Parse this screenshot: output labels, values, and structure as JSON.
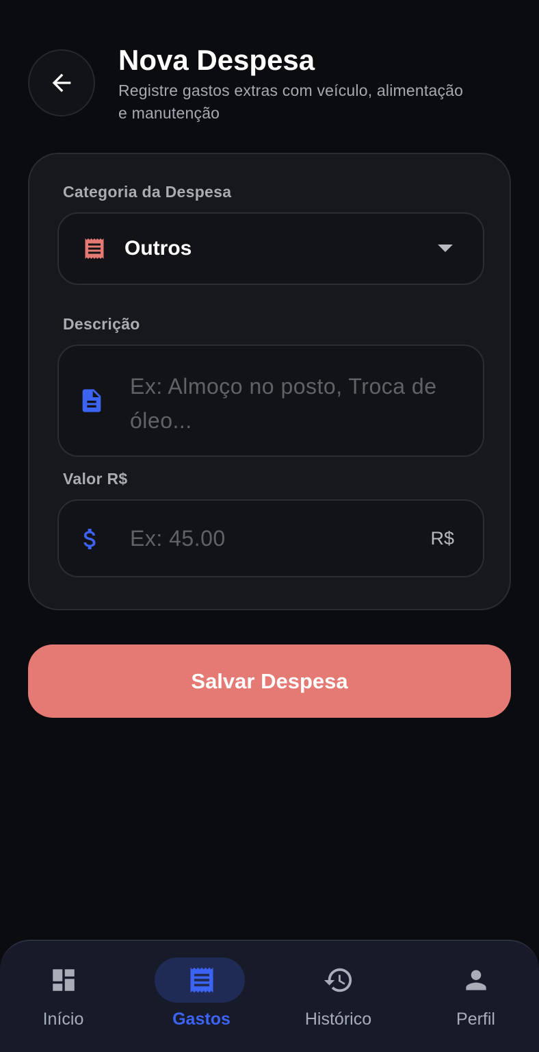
{
  "header": {
    "title": "Nova Despesa",
    "subtitle_line1": "Registre gastos extras com veículo, alimentação",
    "subtitle_line2": "e manutenção"
  },
  "form": {
    "category": {
      "label": "Categoria da Despesa",
      "selected": "Outros",
      "icon": "receipt-icon"
    },
    "description": {
      "label": "Descrição",
      "placeholder_line1": "Ex: Almoço no posto, Troca de",
      "placeholder_line2": "óleo...",
      "icon": "document-icon"
    },
    "amount": {
      "label": "Valor R$",
      "placeholder": "Ex: 45.00",
      "suffix": "R$",
      "icon": "dollar-icon"
    }
  },
  "save_button": {
    "label": "Salvar Despesa"
  },
  "nav": {
    "items": [
      {
        "label": "Início",
        "icon": "dashboard-icon",
        "active": false
      },
      {
        "label": "Gastos",
        "icon": "receipt-icon",
        "active": true
      },
      {
        "label": "Histórico",
        "icon": "history-icon",
        "active": false
      },
      {
        "label": "Perfil",
        "icon": "person-icon",
        "active": false
      }
    ]
  },
  "colors": {
    "background": "#0b0c0f",
    "card": "#17181b",
    "accent_red": "#e57973",
    "accent_blue": "#3d63f2",
    "nav_background": "#161a29"
  }
}
